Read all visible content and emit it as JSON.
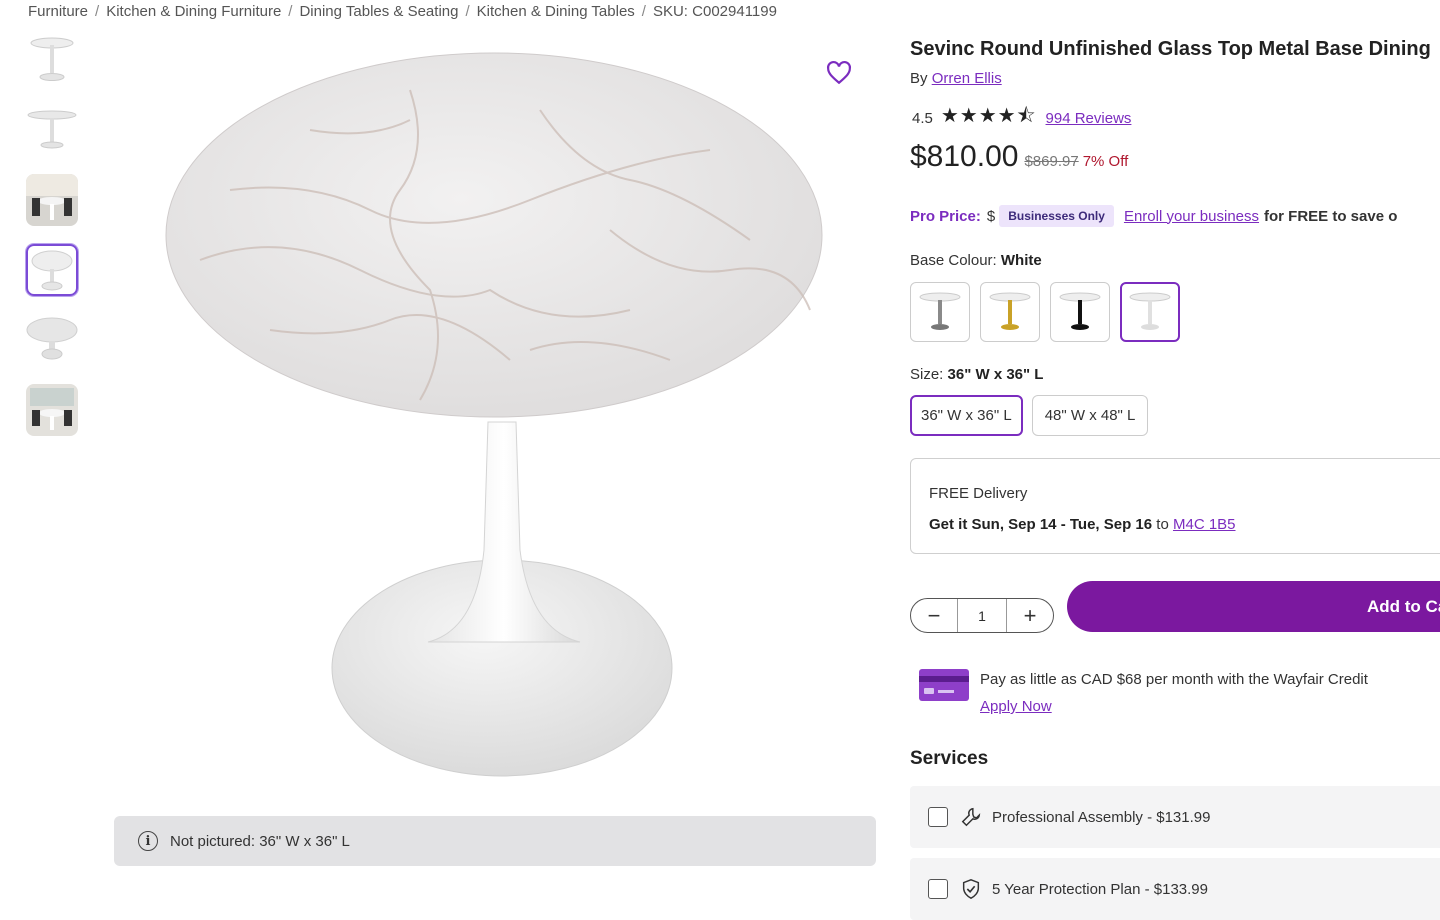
{
  "breadcrumb": {
    "items": [
      "Furniture",
      "Kitchen & Dining Furniture",
      "Dining Tables & Seating",
      "Kitchen & Dining Tables"
    ],
    "sku": "SKU: C002941199"
  },
  "gallery": {
    "notice": "Not pictured: 36\" W x 36\" L",
    "thumbnail_count": 6,
    "active_thumbnail": 4
  },
  "product": {
    "title": "Sevinc Round Unfinished Glass Top Metal Base Dining",
    "by_label": "By",
    "brand": "Orren Ellis",
    "rating": "4.5",
    "stars": "★★★★⯪",
    "reviews": "994 Reviews",
    "price": "$810.00",
    "old_price": "$869.97",
    "discount": "7% Off"
  },
  "pro_price": {
    "label": "Pro Price:",
    "dollar": "$",
    "badge": "Businesses Only",
    "enroll_link": "Enroll your business",
    "suffix": "for FREE to save o"
  },
  "colour": {
    "label": "Base Colour:",
    "selected": "White",
    "options": [
      "Silver",
      "Gold",
      "Black",
      "White"
    ],
    "colors": [
      "#8a8a8a",
      "#c9a227",
      "#111111",
      "#dddddd"
    ]
  },
  "size": {
    "label": "Size:",
    "selected": "36\" W x 36\" L",
    "options": [
      "36\" W x 36\" L",
      "48\" W x 48\" L"
    ]
  },
  "delivery": {
    "title": "FREE Delivery",
    "get_it": "Get it Sun, Sep 14 - Tue, Sep 16",
    "to": "to",
    "postal": "M4C 1B5"
  },
  "cart": {
    "qty_minus": "−",
    "qty_value": "1",
    "qty_plus": "+",
    "add_label": "Add to Ca"
  },
  "credit": {
    "text": "Pay as little as CAD $68 per month with the Wayfair Credit",
    "apply": "Apply Now"
  },
  "services": {
    "heading": "Services",
    "items": [
      {
        "label": "Professional Assembly - $131.99",
        "icon": "wrench-icon"
      },
      {
        "label": "5 Year Protection Plan - $133.99",
        "icon": "shield-check-icon"
      }
    ]
  },
  "colors": {
    "accent": "#7b2cbf",
    "add_to_cart": "#7b189f",
    "discount": "#b0182f"
  }
}
